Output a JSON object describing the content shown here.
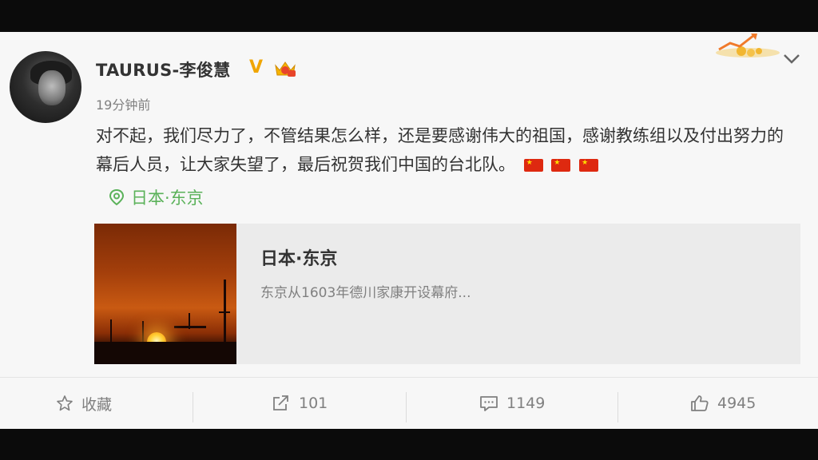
{
  "post": {
    "username": "TAURUS-李俊慧",
    "verified_badge": "V",
    "timestamp": "19分钟前",
    "content": "对不起，我们尽力了，不管结果怎么样，还是要感谢伟大的祖国，感谢教练组以及付出努力的幕后人员，让大家失望了，最后祝贺我们中国的台北队。",
    "flag_count": 3,
    "location": "日本·东京",
    "icons": {
      "more": "chevron-down-icon",
      "location": "location-pin-icon",
      "flag": "china-flag-emoji"
    }
  },
  "card": {
    "title": "日本·东京",
    "description": "东京从1603年德川家康开设幕府..."
  },
  "actions": {
    "favorite_label": "收藏",
    "repost_count": "101",
    "comment_count": "1149",
    "like_count": "4945"
  },
  "colors": {
    "location_green": "#5bb25a",
    "verified_gold": "#f0a500",
    "text_primary": "#333333",
    "text_secondary": "#808080",
    "flag_red": "#de2910"
  }
}
